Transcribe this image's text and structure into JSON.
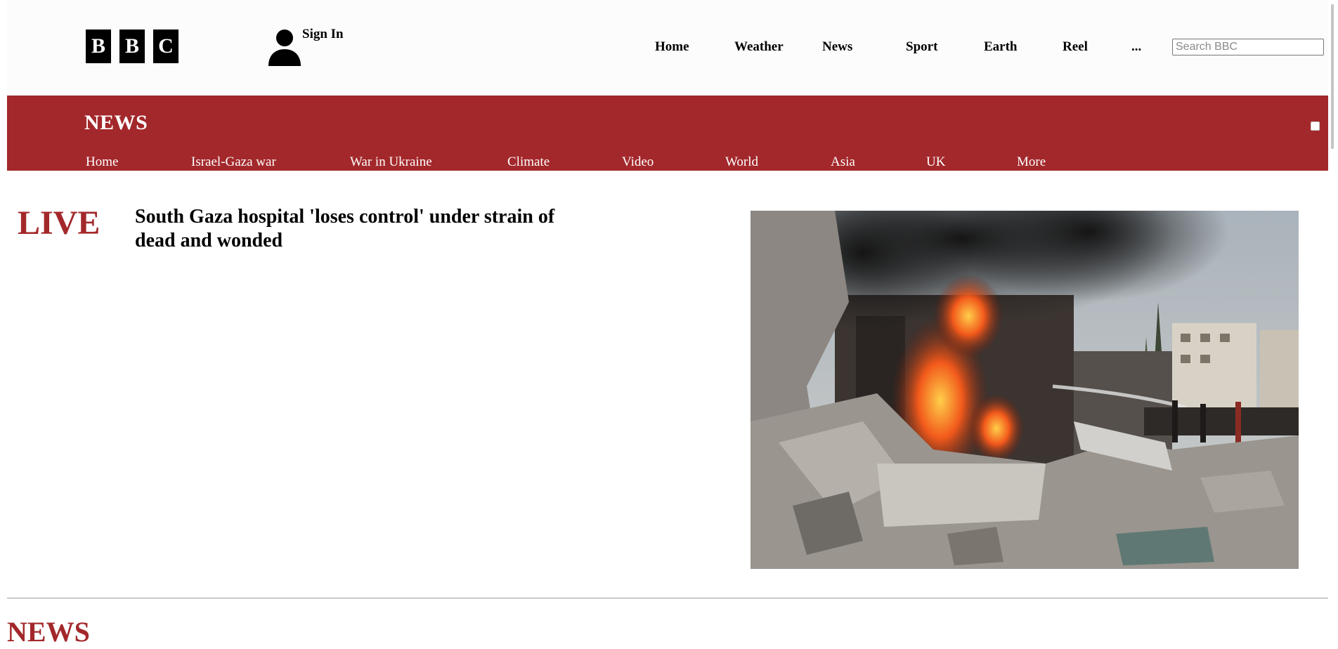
{
  "header": {
    "logo_letters": [
      "B",
      "B",
      "C"
    ],
    "sign_in_label": "Sign In",
    "nav": [
      {
        "label": "Home"
      },
      {
        "label": "Weather"
      },
      {
        "label": "News"
      },
      {
        "label": "Sport"
      },
      {
        "label": "Earth"
      },
      {
        "label": "Reel"
      },
      {
        "label": "..."
      }
    ],
    "search_placeholder": "Search BBC"
  },
  "news_banner": {
    "title": "NEWS",
    "nav": [
      {
        "label": "Home"
      },
      {
        "label": "Israel-Gaza war"
      },
      {
        "label": "War in Ukraine"
      },
      {
        "label": "Climate"
      },
      {
        "label": "Video"
      },
      {
        "label": "World"
      },
      {
        "label": "Asia"
      },
      {
        "label": "UK"
      },
      {
        "label": "More"
      }
    ]
  },
  "main": {
    "live_label": "LIVE",
    "headline": "South Gaza hospital 'loses control' under strain of dead and wonded",
    "section_title": "NEWS"
  },
  "colors": {
    "brand_red": "#a3282b",
    "header_bg": "#fcfcfc",
    "logo_block": "#000000"
  },
  "icons": {
    "user": "user-icon",
    "hero": "hero-image"
  }
}
